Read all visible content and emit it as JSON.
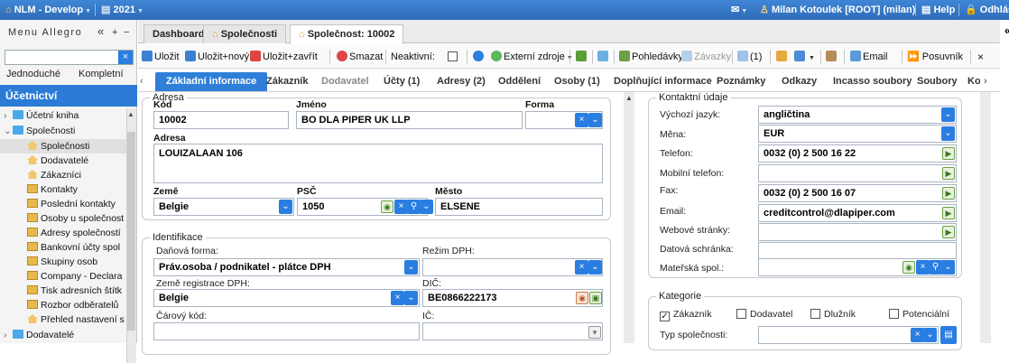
{
  "topbar": {
    "app_title": "NLM - Develop",
    "year": "2021",
    "user": "Milan Kotoulek [ROOT] (milan)",
    "help": "Help",
    "logout": "Odhlásit"
  },
  "sidebar": {
    "title": "Menu Allegro",
    "collapse": "«",
    "plus": "+",
    "minus": "−",
    "search_value": "",
    "mode_simple": "Jednoduché",
    "mode_full": "Kompletní",
    "section": "Účetnictví",
    "tree": [
      {
        "label": "Účetní kniha",
        "kind": "folder"
      },
      {
        "label": "Společnosti",
        "kind": "folder"
      },
      {
        "label": "Společnosti",
        "kind": "house"
      },
      {
        "label": "Dodavatelé",
        "kind": "house"
      },
      {
        "label": "Zákazníci",
        "kind": "house"
      },
      {
        "label": "Kontakty",
        "kind": "doc"
      },
      {
        "label": "Poslední kontakty",
        "kind": "doc"
      },
      {
        "label": "Osoby u společnost",
        "kind": "doc"
      },
      {
        "label": "Adresy společností",
        "kind": "doc"
      },
      {
        "label": "Bankovní účty spol",
        "kind": "doc"
      },
      {
        "label": "Skupiny osob",
        "kind": "doc"
      },
      {
        "label": "Company - Declara",
        "kind": "doc"
      },
      {
        "label": "Tisk adresních štítk",
        "kind": "doc"
      },
      {
        "label": "Rozbor odběratelů",
        "kind": "doc"
      },
      {
        "label": "Přehled nastavení s",
        "kind": "house"
      },
      {
        "label": "Dodavatelé",
        "kind": "folder"
      }
    ]
  },
  "main_tabs": [
    "Dashboard",
    "Společnosti",
    "Společnost: 10002"
  ],
  "toolbar": {
    "save": "Uložit",
    "save_new": "Uložit+nový",
    "save_close": "Uložit+zavřít",
    "delete": "Smazat",
    "inactive": "Neaktivní:",
    "external": "Externí zdroje",
    "receivables": "Pohledávky",
    "payables": "Závazky",
    "mail_count": "(1)",
    "email": "Email",
    "shift": "Posuvník",
    "close": "×"
  },
  "sub_tabs": [
    "Základní informace",
    "Zákazník",
    "Dodavatel",
    "Účty (1)",
    "Adresy (2)",
    "Oddělení",
    "Osoby (1)",
    "Doplňující informace",
    "Poznámky",
    "Odkazy",
    "Incasso soubory",
    "Soubory",
    "Ko"
  ],
  "adresa": {
    "legend": "Adresa",
    "code_label": "Kód",
    "code": "10002",
    "name_label": "Jméno",
    "name": "BO DLA PIPER UK LLP",
    "form_label": "Forma",
    "form": "",
    "address_label": "Adresa",
    "address": "LOUIZALAAN 106",
    "country_label": "Země",
    "country": "Belgie",
    "zip_label": "PSČ",
    "zip": "1050",
    "city_label": "Město",
    "city": "ELSENE"
  },
  "identifikace": {
    "legend": "Identifikace",
    "tax_form_label": "Daňová forma:",
    "tax_form": "Práv.osoba / podnikatel - plátce DPH",
    "vat_mode_label": "Režim DPH:",
    "vat_mode": "",
    "vat_country_label": "Země registrace DPH:",
    "vat_country": "Belgie",
    "dic_label": "DIČ:",
    "dic": "BE0866222173",
    "barcode_label": "Čárový kód:",
    "barcode": "",
    "ic_label": "IČ:",
    "ic": ""
  },
  "kontakt": {
    "legend": "Kontaktní údaje",
    "language_label": "Výchozí jazyk:",
    "language": "angličtina",
    "currency_label": "Měna:",
    "currency": "EUR",
    "phone_label": "Telefon:",
    "phone": "0032 (0) 2 500 16 22",
    "mobile_label": "Mobilní telefon:",
    "mobile": "",
    "fax_label": "Fax:",
    "fax": "0032 (0) 2 500 16 07",
    "email_label": "Email:",
    "email": "creditcontrol@dlapiper.com",
    "web_label": "Webové stránky:",
    "web": "",
    "databox_label": "Datová schránka:",
    "databox": "",
    "parent_label": "Mateřská spol.:",
    "parent": ""
  },
  "kategorie": {
    "legend": "Kategorie",
    "customer": "Zákazník",
    "customer_checked": true,
    "supplier": "Dodavatel",
    "supplier_checked": false,
    "debtor": "Dlužník",
    "debtor_checked": false,
    "potential": "Potenciální",
    "potential_checked": false,
    "company_type_label": "Typ společnosti:",
    "company_type": ""
  }
}
